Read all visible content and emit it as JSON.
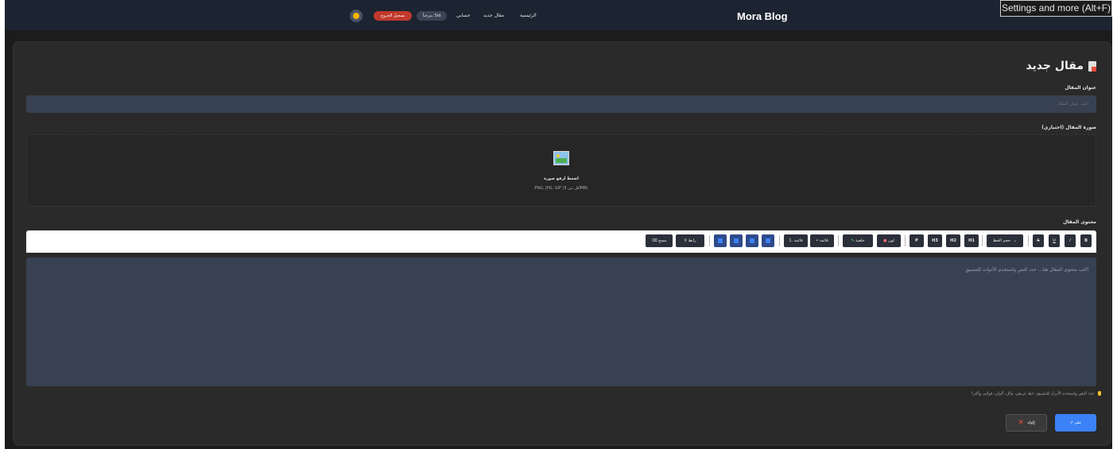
{
  "header": {
    "brand": "Mora Blog",
    "nav": {
      "home": "الرئيسية",
      "new_post": "مقال جديد",
      "account": "حسابي"
    },
    "user_pill": "مرحباً، Sid",
    "logout": "تسجيل الخروج",
    "tooltip": "Settings and more (Alt+F)"
  },
  "page": {
    "title": "مقال جديد",
    "title_label": "عنوان المقال",
    "title_placeholder": "اكتب عنوان المقال...",
    "image_label": "صورة المقال (اختياري)",
    "upload_text": "اضغط لرفع صورة",
    "upload_hint": "PNG, JPG, GIF (أقل من 5MB)",
    "content_label": "محتوى المقال"
  },
  "toolbar": {
    "bold": "B",
    "italic": "I",
    "underline": "U",
    "strike": "S",
    "font_size": "حجم الخط",
    "h1": "H1",
    "h2": "H2",
    "h3": "H3",
    "p": "P",
    "color": "لون",
    "highlight": "خلفية",
    "bullets": "• قائمة",
    "numbered": "1. قائمة",
    "link": "رابط",
    "clear": "مسح"
  },
  "editor": {
    "placeholder": "اكتب محتوى المقال هنا... حدد النص واستخدم الأدوات للتنسيق"
  },
  "tip": "حدد النص واستخدم الأزرار للتنسيق: خط عريض، مائل، ألوان، قوائم، وأكثر!",
  "actions": {
    "publish": "نشر",
    "cancel": "إلغاء"
  },
  "colors": {
    "accent": "#3b82f6",
    "danger": "#c0392b",
    "surface": "#2a2a2a",
    "input": "#374151"
  }
}
